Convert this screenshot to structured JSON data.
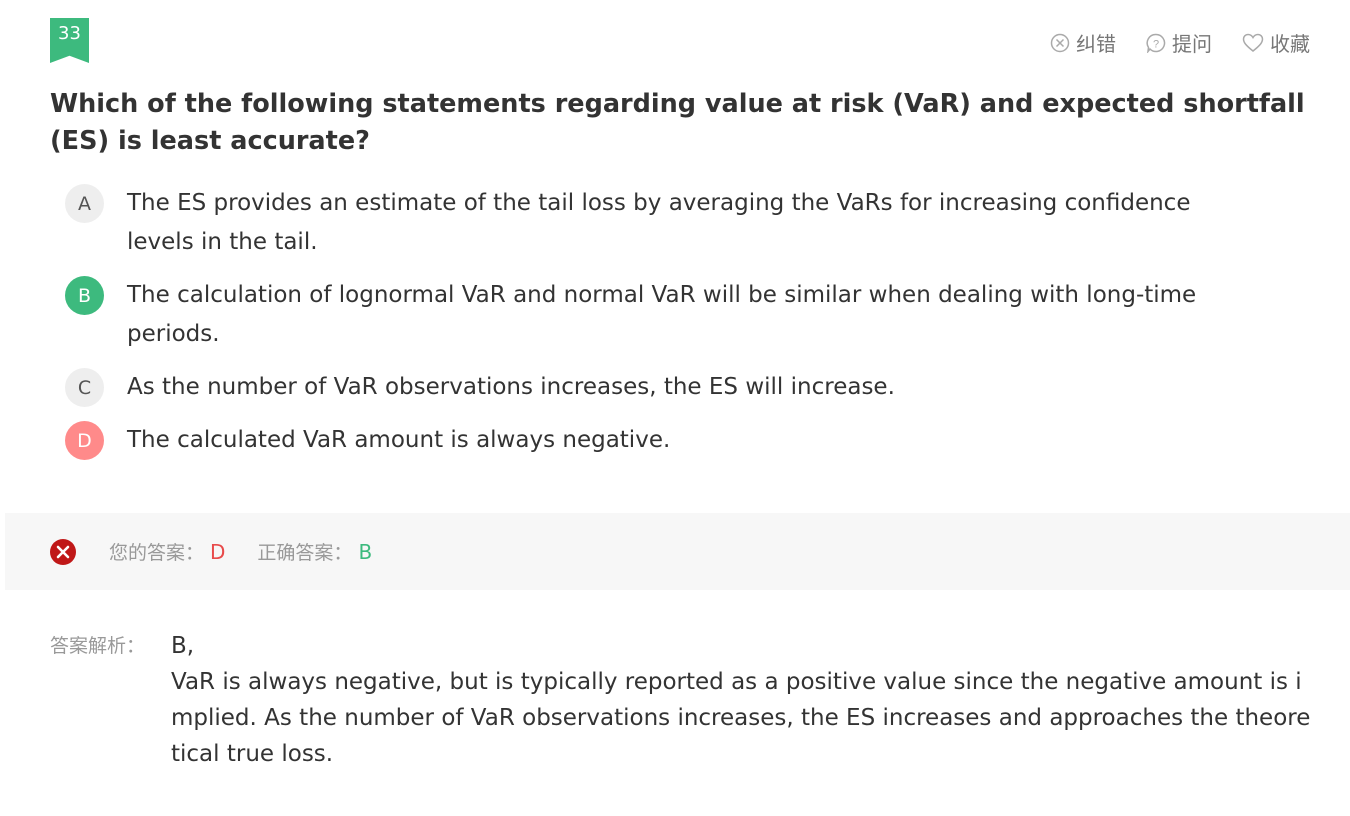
{
  "question_number": "33",
  "toolbar": {
    "report_label": "纠错",
    "ask_label": "提问",
    "favorite_label": "收藏"
  },
  "question": "Which of the following statements regarding value at risk (VaR) and expected shortfall (ES) is least accurate?",
  "options": [
    {
      "letter": "A",
      "text": "The ES provides an estimate of the tail loss by averaging the VaRs for increasing confidence levels in the tail.",
      "state": "normal"
    },
    {
      "letter": "B",
      "text": "The calculation of lognormal VaR and normal VaR will be similar when dealing with long-time periods.",
      "state": "correct"
    },
    {
      "letter": "C",
      "text": "As the number of VaR observations increases, the ES will increase.",
      "state": "normal"
    },
    {
      "letter": "D",
      "text": "The calculated VaR amount is always negative.",
      "state": "wrong"
    }
  ],
  "result": {
    "your_answer_label": "您的答案：",
    "your_answer": "D",
    "correct_answer_label": "正确答案：",
    "correct_answer": "B"
  },
  "explanation": {
    "label": "答案解析：",
    "first_line": "B,",
    "text": "VaR is always negative, but is typically reported as a positive value since the negative amount is implied. As the number of VaR observations increases, the ES increases and approaches the theoretical true loss."
  },
  "colors": {
    "accent_green": "#3dba7e",
    "wrong_red": "#ff8a8a",
    "error_icon_red": "#c01818",
    "your_answer_red": "#e84a4a"
  }
}
